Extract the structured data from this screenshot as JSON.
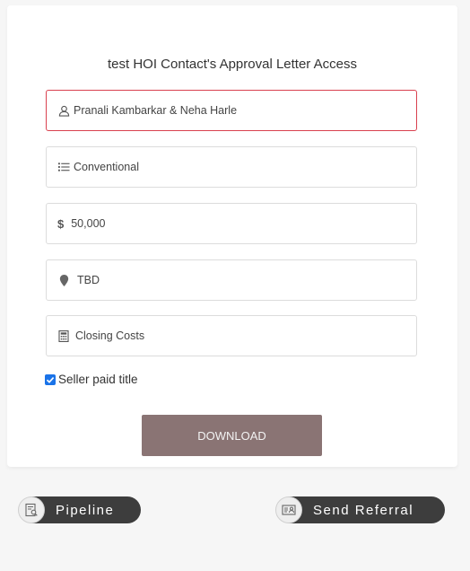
{
  "form": {
    "title": "test HOI Contact's Approval Letter Access",
    "fields": [
      {
        "icon": "user-icon",
        "value": "Pranali Kambarkar & Neha Harle"
      },
      {
        "icon": "list-icon",
        "value": "Conventional"
      },
      {
        "icon": "dollar-icon",
        "symbol": "$",
        "value": "50,000"
      },
      {
        "icon": "map-pin-icon",
        "value": "TBD"
      },
      {
        "icon": "calculator-icon",
        "value": "Closing Costs"
      }
    ],
    "checkbox": {
      "label": "Seller paid title",
      "checked": true
    },
    "download_label": "DOWNLOAD"
  },
  "footer": {
    "pipeline_label": "Pipeline",
    "pipeline_icon": "clipboard-search-icon",
    "referral_label": "Send Referral",
    "referral_icon": "contact-card-icon"
  },
  "colors": {
    "error_border": "#d9414f",
    "download_bg": "#8a7474",
    "pill_bg": "#3d3d3d",
    "checkbox": "#1a73e8"
  }
}
